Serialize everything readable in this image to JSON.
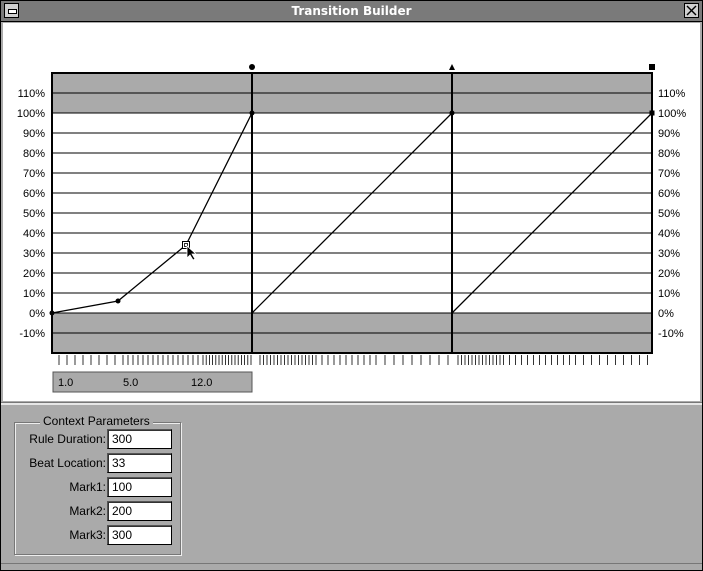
{
  "window": {
    "title": "Transition Builder"
  },
  "graph": {
    "y_ticks": [
      "110%",
      "100%",
      "90%",
      "80%",
      "70%",
      "60%",
      "50%",
      "40%",
      "30%",
      "20%",
      "10%",
      "0%",
      "-10%"
    ],
    "y_values": [
      110,
      100,
      90,
      80,
      70,
      60,
      50,
      40,
      30,
      20,
      10,
      0,
      -10
    ],
    "marker_symbols": [
      "circle",
      "triangle",
      "square"
    ],
    "segment1_points": [
      {
        "t": 0.0,
        "v": 0
      },
      {
        "t": 0.33,
        "v": 6
      },
      {
        "t": 0.67,
        "v": 34
      },
      {
        "t": 1.0,
        "v": 100
      }
    ],
    "selected_point_index": 2,
    "ruler_labels": [
      "1.0",
      "5.0",
      "12.0"
    ]
  },
  "context_parameters": {
    "title": "Context Parameters",
    "fields": [
      {
        "label": "Rule Duration:",
        "value": "300"
      },
      {
        "label": "Beat Location:",
        "value": "33"
      },
      {
        "label": "Mark1:",
        "value": "100"
      },
      {
        "label": "Mark2:",
        "value": "200"
      },
      {
        "label": "Mark3:",
        "value": "300"
      }
    ]
  }
}
